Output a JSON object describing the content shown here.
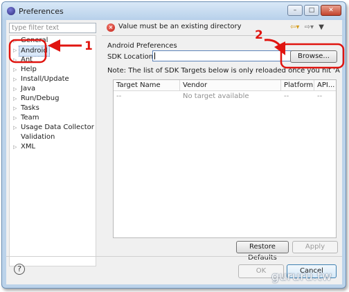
{
  "window": {
    "title": "Preferences",
    "controls": {
      "minimize": "–",
      "maximize": "□",
      "close": "✕"
    }
  },
  "sidebar": {
    "filter_placeholder": "type filter text",
    "items": [
      {
        "label": "General",
        "expandable": true
      },
      {
        "label": "Android",
        "expandable": true,
        "selected": true
      },
      {
        "label": "Ant",
        "expandable": true
      },
      {
        "label": "Help",
        "expandable": true
      },
      {
        "label": "Install/Update",
        "expandable": true
      },
      {
        "label": "Java",
        "expandable": true
      },
      {
        "label": "Run/Debug",
        "expandable": true
      },
      {
        "label": "Tasks",
        "expandable": true
      },
      {
        "label": "Team",
        "expandable": true
      },
      {
        "label": "Usage Data Collector",
        "expandable": true
      },
      {
        "label": "Validation",
        "expandable": false
      },
      {
        "label": "XML",
        "expandable": true
      }
    ]
  },
  "header": {
    "error_message": "Value must be an existing directory",
    "error_icon": "error-icon",
    "nav_icons": [
      "back-arrow-icon",
      "forward-arrow-icon",
      "dropdown-menu-icon"
    ]
  },
  "page": {
    "section_title": "Android Preferences",
    "sdk_location_label": "SDK Location:",
    "sdk_location_value": "",
    "browse_label": "Browse...",
    "note": "Note: The list of SDK Targets below is only reloaded once you hit 'Apply' or 'OK'.",
    "table": {
      "columns": [
        "Target Name",
        "Vendor",
        "Platform",
        "API..."
      ],
      "rows": [
        [
          "--",
          "No target available",
          "--",
          "--"
        ]
      ]
    },
    "restore_defaults_label": "Restore Defaults",
    "apply_label": "Apply"
  },
  "footer": {
    "help_label": "?",
    "ok_label": "OK",
    "cancel_label": "Cancel"
  },
  "annotations": {
    "marker_1": "1",
    "marker_2": "2",
    "color": "#e0140f"
  },
  "watermark": "gururu.tw",
  "colors": {
    "titlebar": "#c8dcf1",
    "selection": "#d9e8f9",
    "error": "#c11c12"
  }
}
